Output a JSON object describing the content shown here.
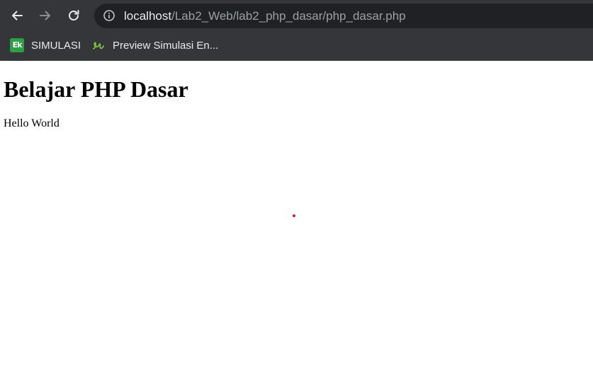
{
  "toolbar": {
    "back_icon": "arrow-left-icon",
    "forward_icon": "arrow-right-icon",
    "reload_icon": "reload-icon",
    "site_info_icon": "info-icon",
    "url_host": "localhost",
    "url_path": "/Lab2_Web/lab2_php_dasar/php_dasar.php"
  },
  "bookmarks": [
    {
      "label": "SIMULASI",
      "icon": "ek-logo-icon",
      "icon_text": "Ek",
      "icon_color": "#2ea043"
    },
    {
      "label": "Preview Simulasi En...",
      "icon": "ek-script-logo-icon",
      "icon_color": "#7cc242"
    }
  ],
  "page": {
    "title": "Belajar PHP Dasar",
    "text": "Hello World"
  },
  "colors": {
    "chrome_bg": "#35363a",
    "omnibox_bg": "#202124",
    "url_host": "#e8eaed",
    "url_path": "#9aa0a6",
    "cursor_dot": "#e01b24"
  }
}
